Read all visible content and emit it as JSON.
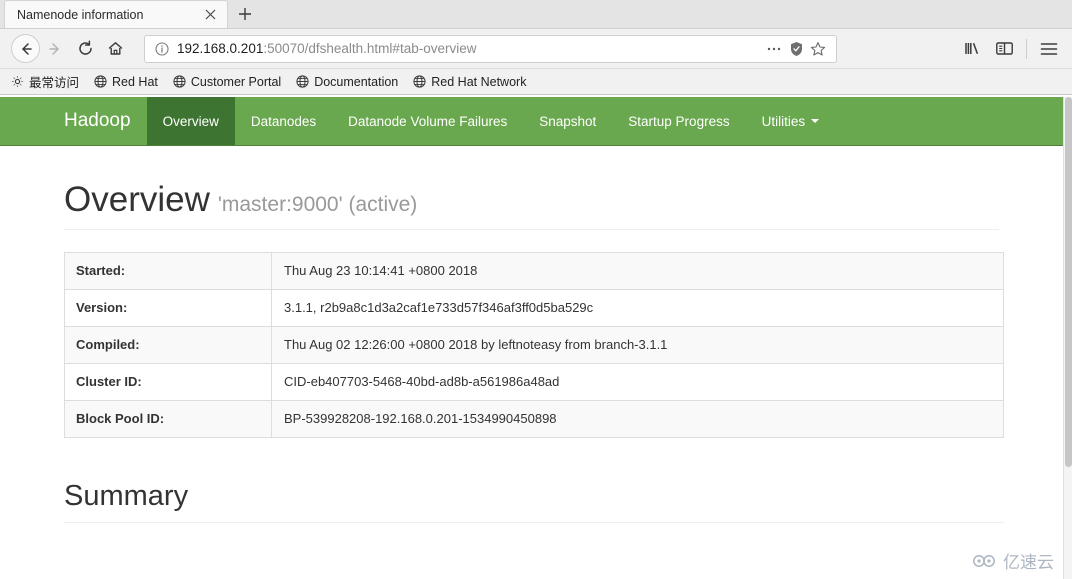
{
  "browser": {
    "tab": {
      "title": "Namenode information",
      "close_icon": "close-icon"
    },
    "newtab_label": "+",
    "nav": {
      "back_icon": "back-arrow-icon",
      "forward_icon": "forward-arrow-icon",
      "reload_icon": "reload-icon",
      "home_icon": "home-icon"
    },
    "url": {
      "info_icon": "page-info-icon",
      "host": "192.168.0.201",
      "path": ":50070/dfshealth.html#tab-overview",
      "full": "192.168.0.201:50070/dfshealth.html#tab-overview",
      "more_icon": "ellipsis-icon",
      "shield_icon": "shield-icon",
      "bookmark_icon": "star-icon"
    },
    "chrome_right": {
      "library_icon": "library-icon",
      "sidebar_icon": "sidebar-icon",
      "menu_icon": "hamburger-menu-icon"
    },
    "bookmarks": [
      {
        "label": "最常访问",
        "icon": "star-settings-icon"
      },
      {
        "label": "Red Hat",
        "icon": "globe-icon"
      },
      {
        "label": "Customer Portal",
        "icon": "globe-icon"
      },
      {
        "label": "Documentation",
        "icon": "globe-icon"
      },
      {
        "label": "Red Hat Network",
        "icon": "globe-icon"
      }
    ]
  },
  "hadoop": {
    "brand": "Hadoop",
    "navbar_color": "#6aa84f",
    "active_color": "#3e7432",
    "nav_items": [
      {
        "label": "Overview",
        "active": true
      },
      {
        "label": "Datanodes",
        "active": false
      },
      {
        "label": "Datanode Volume Failures",
        "active": false
      },
      {
        "label": "Snapshot",
        "active": false
      },
      {
        "label": "Startup Progress",
        "active": false
      },
      {
        "label": "Utilities",
        "active": false,
        "caret": true
      }
    ]
  },
  "main": {
    "heading": "Overview",
    "heading_sub": "'master:9000' (active)",
    "table": [
      {
        "key": "Started:",
        "value": "Thu Aug 23 10:14:41 +0800 2018"
      },
      {
        "key": "Version:",
        "value": "3.1.1, r2b9a8c1d3a2caf1e733d57f346af3ff0d5ba529c"
      },
      {
        "key": "Compiled:",
        "value": "Thu Aug 02 12:26:00 +0800 2018 by leftnoteasy from branch-3.1.1"
      },
      {
        "key": "Cluster ID:",
        "value": "CID-eb407703-5468-40bd-ad8b-a561986a48ad"
      },
      {
        "key": "Block Pool ID:",
        "value": "BP-539928208-192.168.0.201-1534990450898"
      }
    ],
    "summary_heading": "Summary"
  },
  "watermark": {
    "text": "亿速云"
  }
}
